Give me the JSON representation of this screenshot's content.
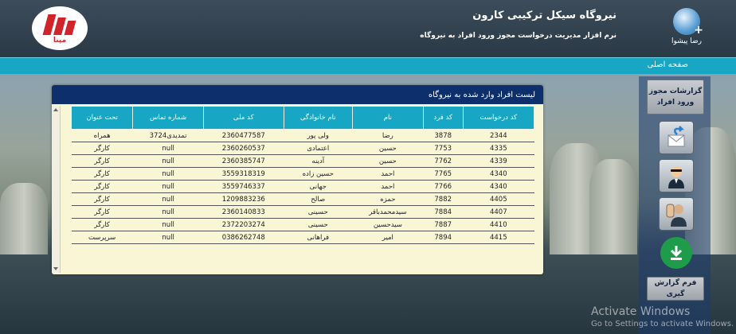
{
  "header": {
    "title": "نیروگاه سیکل ترکیبی کارون",
    "subtitle": "نرم افزار مدیریت درخواست مجوز ورود افراد به نیروگاه",
    "user_name": "رضا پیشوا",
    "logo_text": "مپنا"
  },
  "nav": {
    "home": "صفحه اصلی"
  },
  "panel": {
    "title": "لیست افراد وارد شده به نیروگاه"
  },
  "table": {
    "columns": [
      "کد درخواست",
      "کد فرد",
      "نام",
      "نام خانوادگی",
      "کد ملی",
      "شماره تماس",
      "تحت عنوان"
    ],
    "rows": [
      [
        "2344",
        "3878",
        "رضا",
        "ولی پور",
        "2360477587",
        "تمدیدی3724",
        "همراه"
      ],
      [
        "4335",
        "7753",
        "حسین",
        "اعتمادی",
        "2360260537",
        "null",
        "کارگر"
      ],
      [
        "4339",
        "7762",
        "حسین",
        "آدینه",
        "2360385747",
        "null",
        "کارگر"
      ],
      [
        "4340",
        "7765",
        "احمد",
        "حسین زاده",
        "3559318319",
        "null",
        "کارگر"
      ],
      [
        "4340",
        "7766",
        "احمد",
        "جهانی",
        "3559746337",
        "null",
        "کارگر"
      ],
      [
        "4405",
        "7882",
        "حمزه",
        "صالح",
        "1209883236",
        "null",
        "کارگر"
      ],
      [
        "4407",
        "7884",
        "سیدمحمدباقر",
        "حسینی",
        "2360140833",
        "null",
        "کارگر"
      ],
      [
        "4410",
        "7887",
        "سیدحسین",
        "حسینی",
        "2372203274",
        "null",
        "کارگر"
      ],
      [
        "4415",
        "7894",
        "امیر",
        "فراهانی",
        "0386262748",
        "null",
        "سرپرست"
      ]
    ]
  },
  "sidebar": {
    "reports_label": "گزارشات مجوز ورود افراد",
    "form_label": "فرم گزارش گیری",
    "icons": [
      "send-mail-icon",
      "user-agent-icon",
      "stop-hand-icon",
      "download-icon"
    ]
  },
  "watermark": {
    "title": "Activate Windows",
    "subtitle": "Go to Settings to activate Windows."
  }
}
